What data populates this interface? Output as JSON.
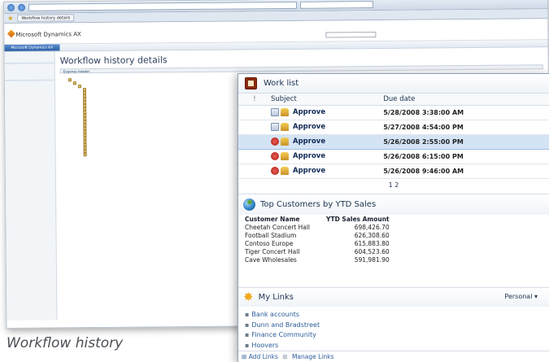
{
  "browser": {
    "tab_label": "Workflow history details",
    "site_title": "Microsoft Dynamics AX",
    "nav_home": "Microsoft Dynamics AX",
    "page_title": "Workflow history details",
    "subbar_label": "Expense header"
  },
  "work_list": {
    "title": "Work list",
    "col_flag": "!",
    "col_subject": "Subject",
    "col_due": "Due date",
    "rows": [
      {
        "subject": "Approve",
        "due": "5/28/2008 3:38:00 AM",
        "icon": "envelope-icon"
      },
      {
        "subject": "Approve",
        "due": "5/27/2008 4:54:00 PM",
        "icon": "envelope-icon"
      },
      {
        "subject": "Approve",
        "due": "5/26/2008 2:55:00 PM",
        "icon": "high-priority-icon"
      },
      {
        "subject": "Approve",
        "due": "5/26/2008 6:15:00 PM",
        "icon": "high-priority-icon"
      },
      {
        "subject": "Approve",
        "due": "5/26/2008 9:46:00 AM",
        "icon": "high-priority-icon"
      }
    ],
    "pager": "1 2"
  },
  "top_customers": {
    "title": "Top Customers by YTD Sales",
    "col_name": "Customer Name",
    "col_amount": "YTD Sales Amount",
    "rows": [
      {
        "name": "Cheetah Concert Hall",
        "amount": "698,426.70"
      },
      {
        "name": "Football Stadium",
        "amount": "626,308.60"
      },
      {
        "name": "Contoso Europe",
        "amount": "615,883.80"
      },
      {
        "name": "Tiger Concert Hall",
        "amount": "604,523.60"
      },
      {
        "name": "Cave Wholesales",
        "amount": "591,981.90"
      }
    ]
  },
  "my_links": {
    "title": "My Links",
    "dropdown": "Personal",
    "items": [
      "Bank accounts",
      "Dunn and Bradstreet",
      "Finance Community",
      "Hoovers"
    ],
    "add_link": "Add Links",
    "manage_link": "Manage Links"
  },
  "caption": "Workflow history"
}
